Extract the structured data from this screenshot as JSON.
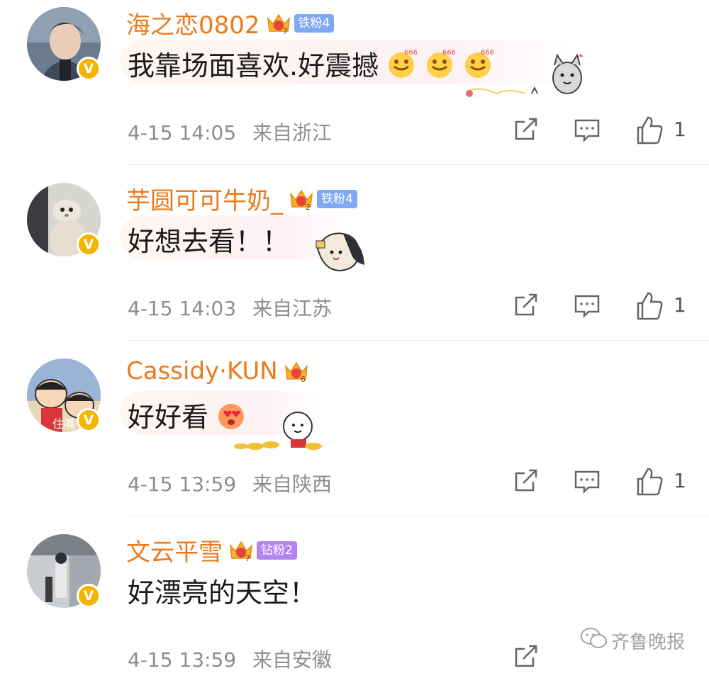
{
  "comments": [
    {
      "username": "海之恋0802",
      "crown_level": "7",
      "fan_badge": "铁粉4",
      "text": "我靠场面喜欢.好震撼",
      "emojis": [
        "666-emoji",
        "666-emoji",
        "666-emoji"
      ],
      "time": "4-15 14:05",
      "location": "来自浙江",
      "likes": "1"
    },
    {
      "username": "芋圆可可牛奶_",
      "crown_level": "2",
      "fan_badge": "铁粉4",
      "text": "好想去看！！",
      "emojis": [],
      "time": "4-15 14:03",
      "location": "来自江苏",
      "likes": "1"
    },
    {
      "username": "Cassidy·KUN",
      "crown_level": "6",
      "fan_badge": "",
      "text": "好好看",
      "emojis": [
        "heart-eyes-emoji"
      ],
      "time": "4-15 13:59",
      "location": "来自陕西",
      "likes": "1"
    },
    {
      "username": "文云平雪",
      "crown_level": "7",
      "fan_badge": "钻粉2",
      "text": "好漂亮的天空！",
      "emojis": [],
      "time": "4-15 13:59",
      "location": "来自安徽",
      "likes": ""
    }
  ],
  "avatar_overlay_text": "住嘴",
  "watermark": "齐鲁晚报",
  "colors": {
    "username": "#ec7a1c",
    "verified_badge": "#f5b400",
    "iron_fan": "#7fa9f5",
    "diamond_fan": "#b383f0",
    "meta": "#8e8e8e"
  }
}
